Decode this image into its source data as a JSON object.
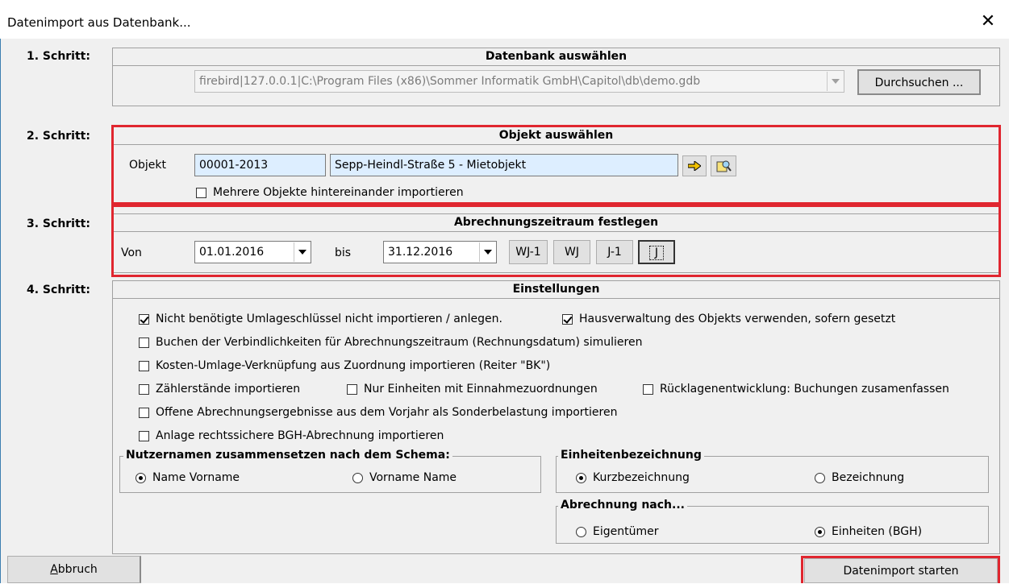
{
  "window": {
    "title": "Datenimport aus Datenbank...",
    "close_icon": "close-icon"
  },
  "steps": {
    "s1": "1. Schritt:",
    "s2": "2. Schritt:",
    "s3": "3. Schritt:",
    "s4": "4. Schritt:"
  },
  "database": {
    "header": "Datenbank auswählen",
    "path": "firebird|127.0.0.1|C:\\Program Files (x86)\\Sommer Informatik GmbH\\Capitol\\db\\demo.gdb",
    "browse_label": "Durchsuchen ..."
  },
  "object": {
    "header": "Objekt auswählen",
    "label": "Objekt",
    "id": "00001-2013",
    "name": "Sepp-Heindl-Straße 5 - Mietobjekt",
    "multi_label": "Mehrere Objekte hintereinander importieren",
    "multi_checked": false
  },
  "period": {
    "header": "Abrechnungszeitraum festlegen",
    "from_label": "Von",
    "from": "01.01.2016",
    "to_label": "bis",
    "to": "31.12.2016",
    "buttons": [
      "WJ-1",
      "WJ",
      "J-1",
      "J"
    ]
  },
  "settings": {
    "header": "Einstellungen",
    "options": [
      {
        "label": "Nicht benötigte Umlageschlüssel nicht importieren / anlegen.",
        "checked": true
      },
      {
        "label": "Hausverwaltung des Objekts verwenden, sofern gesetzt",
        "checked": true
      },
      {
        "label": "Buchen der Verbindlichkeiten für Abrechnungszeitraum (Rechnungsdatum) simulieren",
        "checked": false
      },
      {
        "label": "Kosten-Umlage-Verknüpfung aus Zuordnung importieren (Reiter \"BK\")",
        "checked": false
      },
      {
        "label": "Zählerstände importieren",
        "checked": false
      },
      {
        "label": "Nur Einheiten mit Einnahmezuordnungen",
        "checked": false
      },
      {
        "label": "Rücklagenentwicklung: Buchungen zusamenfassen",
        "checked": false
      },
      {
        "label": "Offene Abrechnungsergebnisse aus dem Vorjahr als Sonderbelastung importieren",
        "checked": false
      },
      {
        "label": "Anlage rechtssichere BGH-Abrechnung importieren",
        "checked": false
      }
    ],
    "user_names": {
      "title": "Nutzernamen zusammensetzen nach dem Schema:",
      "opt1": "Name Vorname",
      "opt2": "Vorname Name",
      "selected": "Name Vorname"
    },
    "unit_names": {
      "title": "Einheitenbezeichnung",
      "opt1": "Kurzbezeichnung",
      "opt2": "Bezeichnung",
      "selected": "Kurzbezeichnung"
    },
    "billing": {
      "title": "Abrechnung nach...",
      "opt1": "Eigentümer",
      "opt2": "Einheiten (BGH)",
      "selected": "Einheiten (BGH)"
    }
  },
  "footer": {
    "cancel_label": "Abbruch",
    "start_label": "Datenimport starten"
  },
  "colors": {
    "highlight": "#e0262f",
    "field_blue": "#ddeeff",
    "window_bg": "#f0f0f0"
  }
}
